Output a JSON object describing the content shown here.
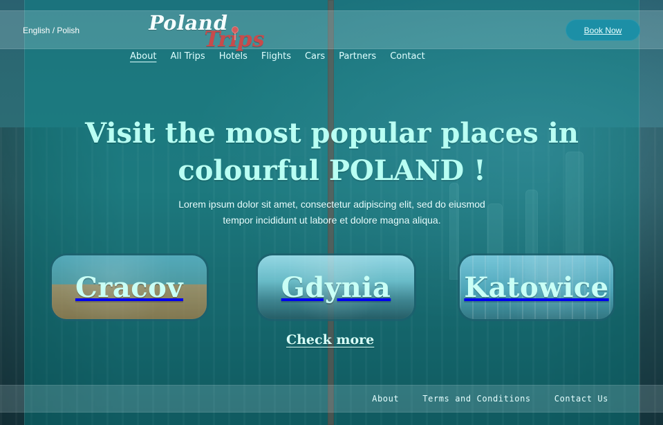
{
  "header": {
    "language_toggle": "English / Polish",
    "logo": {
      "line1": "Poland",
      "line2": "Trips"
    },
    "cta": {
      "book_now": "Book Now"
    },
    "nav": [
      {
        "label": "About",
        "active": true
      },
      {
        "label": "All Trips",
        "active": false
      },
      {
        "label": "Hotels",
        "active": false
      },
      {
        "label": "Flights",
        "active": false
      },
      {
        "label": "Cars",
        "active": false
      },
      {
        "label": "Partners",
        "active": false
      },
      {
        "label": "Contact",
        "active": false
      }
    ]
  },
  "hero": {
    "title_line1": "Visit the most popular places in",
    "title_line2": "colourful POLAND !",
    "subtitle_line1": "Lorem ipsum dolor sit amet, consectetur adipiscing elit, sed do eiusmod",
    "subtitle_line2": "tempor incididunt ut labore et dolore magna aliqua."
  },
  "destinations": [
    {
      "name": "Cracov"
    },
    {
      "name": "Gdynia"
    },
    {
      "name": "Katowice"
    }
  ],
  "actions": {
    "check_more": "Check more"
  },
  "footer": {
    "links": [
      {
        "label": "About"
      },
      {
        "label": "Terms and Conditions"
      },
      {
        "label": "Contact Us"
      }
    ]
  },
  "theme": {
    "overlay": "#009696",
    "accent_button": "#1c8fa6",
    "logo_red": "#c84b4b",
    "hero_text": "#b9fff3"
  }
}
